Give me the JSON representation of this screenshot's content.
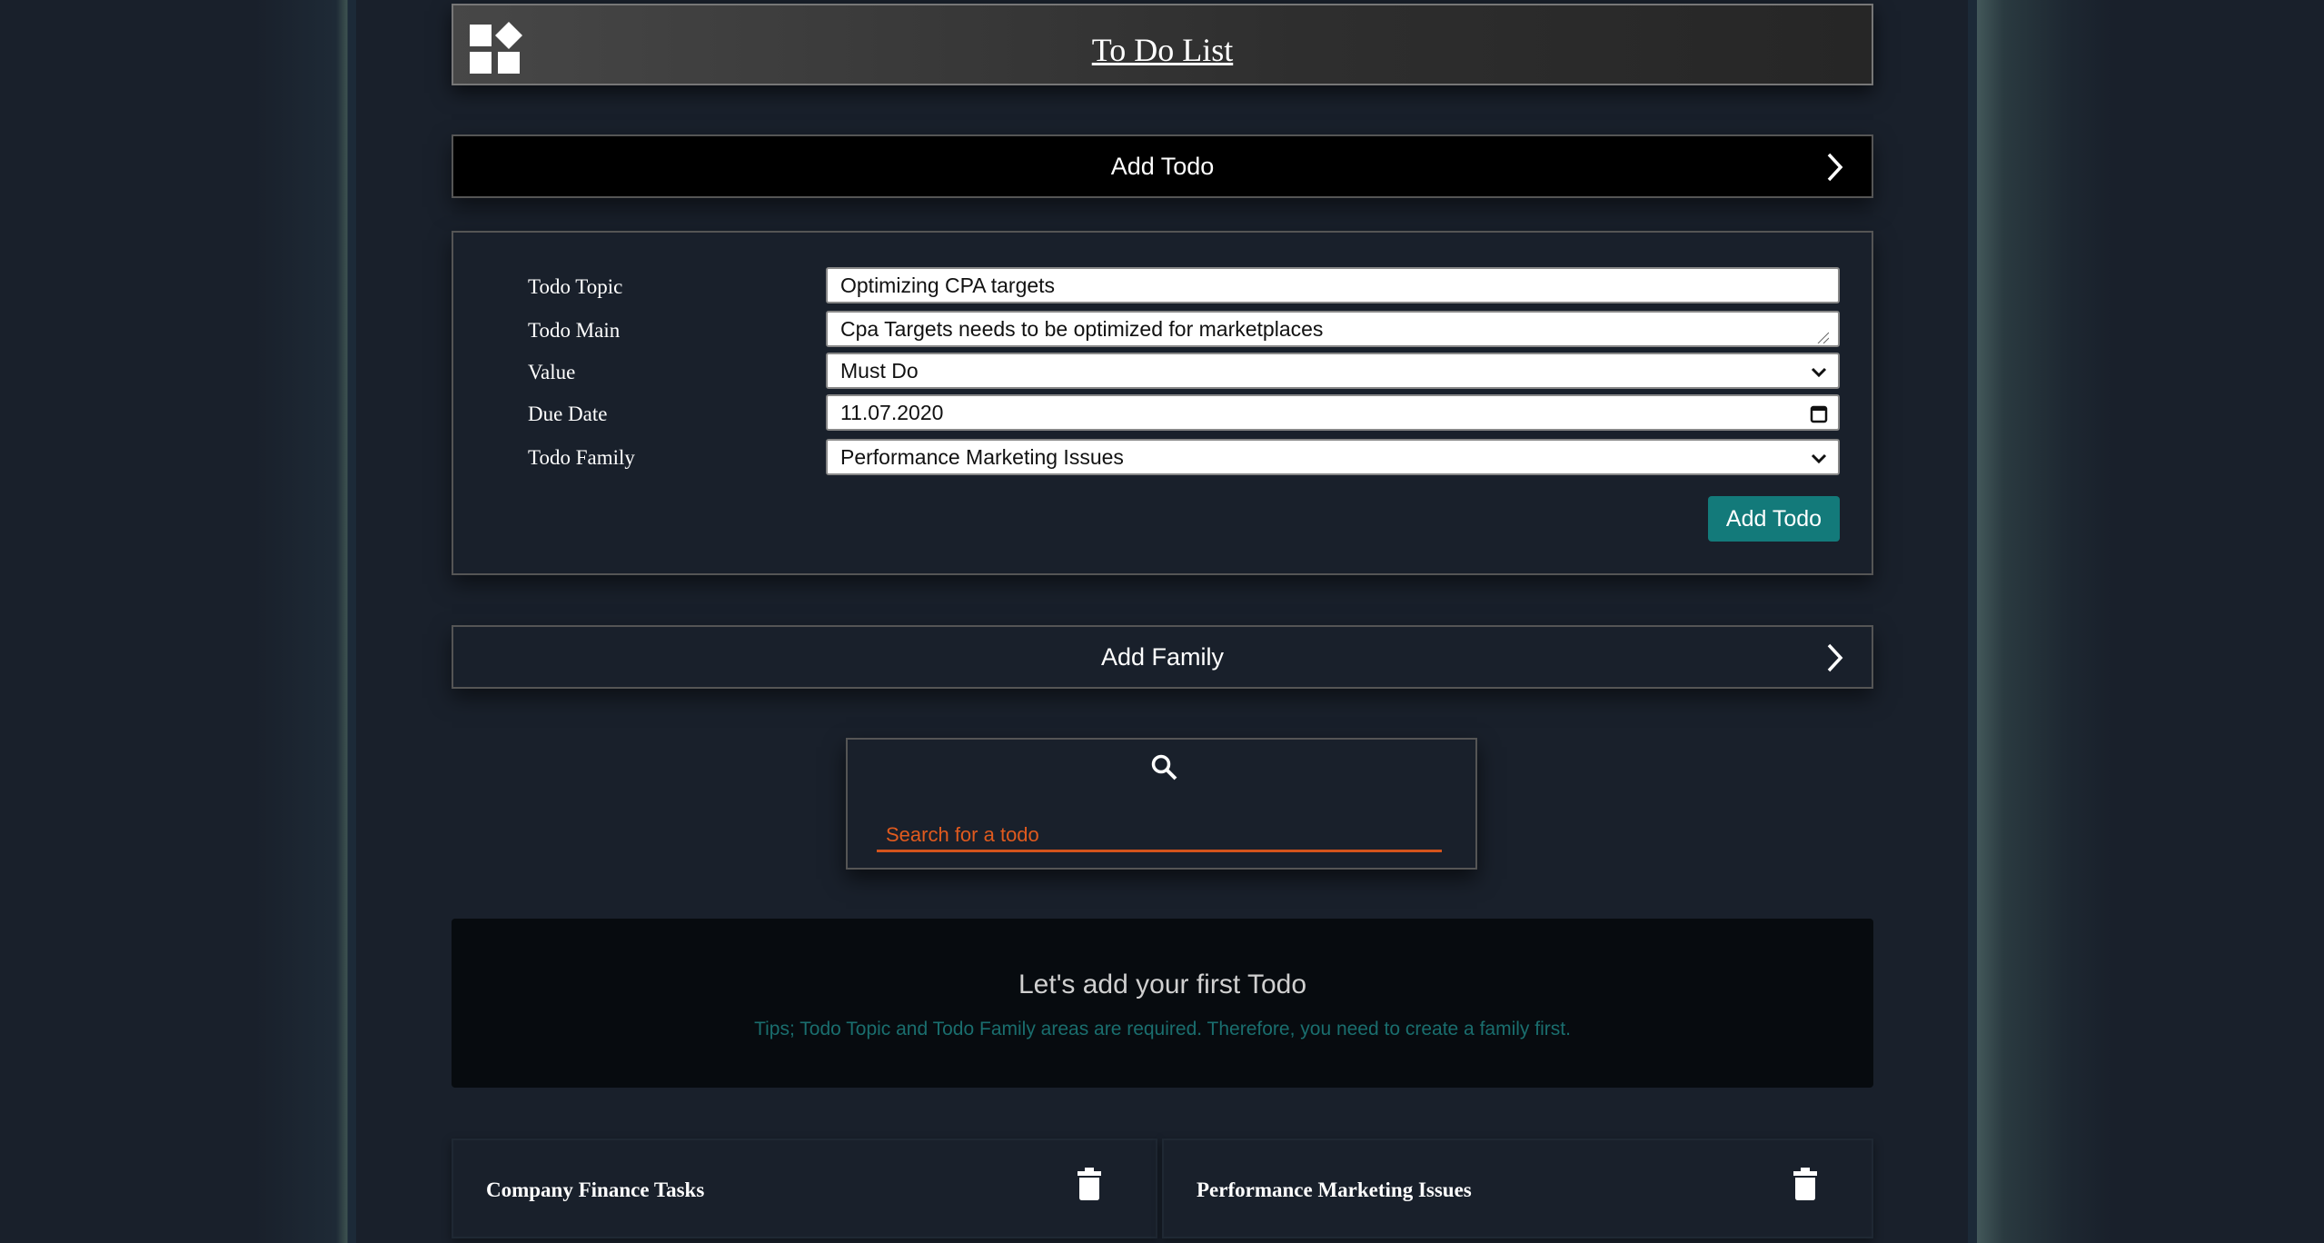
{
  "header": {
    "title": "To Do List",
    "logo_icon": "widgets-icon"
  },
  "add_todo_bar": {
    "label": "Add Todo"
  },
  "form": {
    "fields": [
      {
        "label": "Todo Topic",
        "value": "Optimizing CPA targets"
      },
      {
        "label": "Todo Main",
        "value": "Cpa Targets needs to be optimized for marketplaces"
      },
      {
        "label": "Value",
        "value": "Must Do"
      },
      {
        "label": "Due Date",
        "value": "11.07.2020"
      },
      {
        "label": "Todo Family",
        "value": "Performance Marketing Issues"
      }
    ],
    "submit_label": "Add Todo"
  },
  "add_family_bar": {
    "label": "Add Family"
  },
  "search": {
    "placeholder": "Search for a todo"
  },
  "empty_state": {
    "title": "Let's add your first Todo",
    "tip": "Tips; Todo Topic and Todo Family areas are required. Therefore, you need to create a family first."
  },
  "families": [
    {
      "name": "Company Finance Tasks"
    },
    {
      "name": "Performance Marketing Issues"
    }
  ],
  "colors": {
    "accent": "#137a7a",
    "search": "#e05a1e",
    "background": "#19202b"
  }
}
